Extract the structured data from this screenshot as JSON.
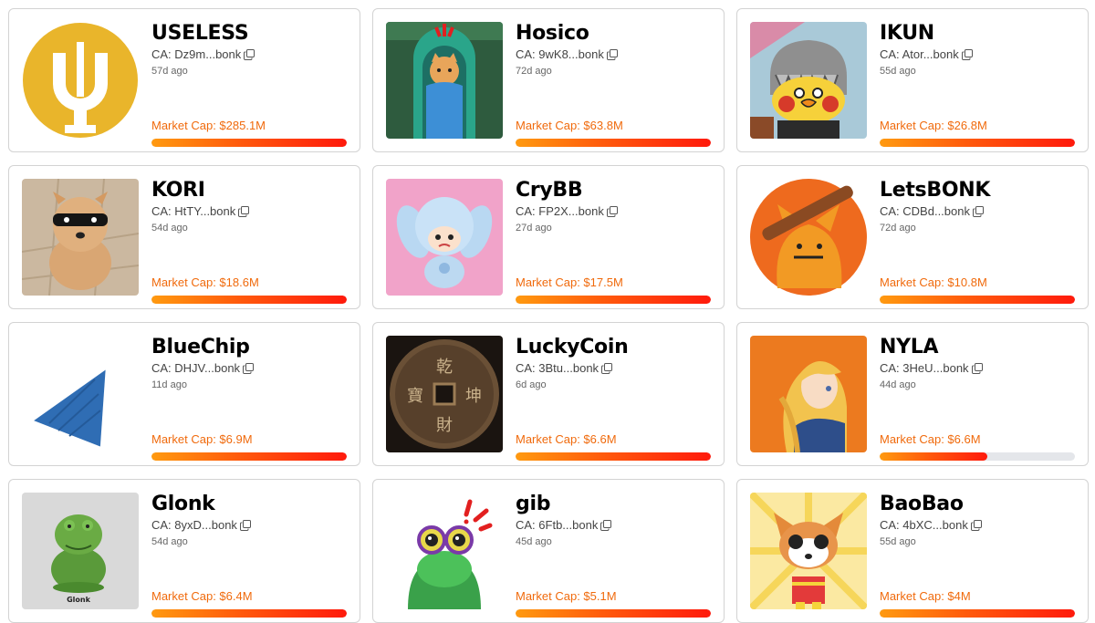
{
  "tokens": [
    {
      "name": "USELESS",
      "ca": "CA: Dz9m...bonk",
      "age": "57d ago",
      "market_cap": "Market Cap: $285.1M",
      "progress": 1.0,
      "image_icon": "useless-logo"
    },
    {
      "name": "Hosico",
      "ca": "CA: 9wK8...bonk",
      "age": "72d ago",
      "market_cap": "Market Cap: $63.8M",
      "progress": 1.0,
      "image_icon": "hosico-cat"
    },
    {
      "name": "IKUN",
      "ca": "CA: Ator...bonk",
      "age": "55d ago",
      "market_cap": "Market Cap: $26.8M",
      "progress": 1.0,
      "image_icon": "ikun-chick"
    },
    {
      "name": "KORI",
      "ca": "CA: HtTY...bonk",
      "age": "54d ago",
      "market_cap": "Market Cap: $18.6M",
      "progress": 1.0,
      "image_icon": "kori-dog"
    },
    {
      "name": "CryBB",
      "ca": "CA: FP2X...bonk",
      "age": "27d ago",
      "market_cap": "Market Cap: $17.5M",
      "progress": 1.0,
      "image_icon": "crybb-doll"
    },
    {
      "name": "LetsBONK",
      "ca": "CA: CDBd...bonk",
      "age": "72d ago",
      "market_cap": "Market Cap: $10.8M",
      "progress": 1.0,
      "image_icon": "letsbonk-dog"
    },
    {
      "name": "BlueChip",
      "ca": "CA: DHJV...bonk",
      "age": "11d ago",
      "market_cap": "Market Cap: $6.9M",
      "progress": 1.0,
      "image_icon": "bluechip-chip"
    },
    {
      "name": "LuckyCoin",
      "ca": "CA: 3Btu...bonk",
      "age": "6d ago",
      "market_cap": "Market Cap: $6.6M",
      "progress": 1.0,
      "image_icon": "lucky-coin"
    },
    {
      "name": "NYLA",
      "ca": "CA: 3HeU...bonk",
      "age": "44d ago",
      "market_cap": "Market Cap: $6.6M",
      "progress": 0.55,
      "image_icon": "nyla-girl"
    },
    {
      "name": "Glonk",
      "ca": "CA: 8yxD...bonk",
      "age": "54d ago",
      "market_cap": "Market Cap: $6.4M",
      "progress": 1.0,
      "image_icon": "glonk-frog",
      "image_caption": "Glonk"
    },
    {
      "name": "gib",
      "ca": "CA: 6Ftb...bonk",
      "age": "45d ago",
      "market_cap": "Market Cap: $5.1M",
      "progress": 1.0,
      "image_icon": "gib-frog"
    },
    {
      "name": "BaoBao",
      "ca": "CA: 4bXC...bonk",
      "age": "55d ago",
      "market_cap": "Market Cap: $4M",
      "progress": 1.0,
      "image_icon": "baobao-dog"
    }
  ],
  "colors": {
    "market_cap_text": "#f06a0c",
    "bar_start": "#ff9a10",
    "bar_end": "#ff1a0c",
    "bar_track": "#e4e6ea",
    "card_border": "#d3d3d3"
  }
}
